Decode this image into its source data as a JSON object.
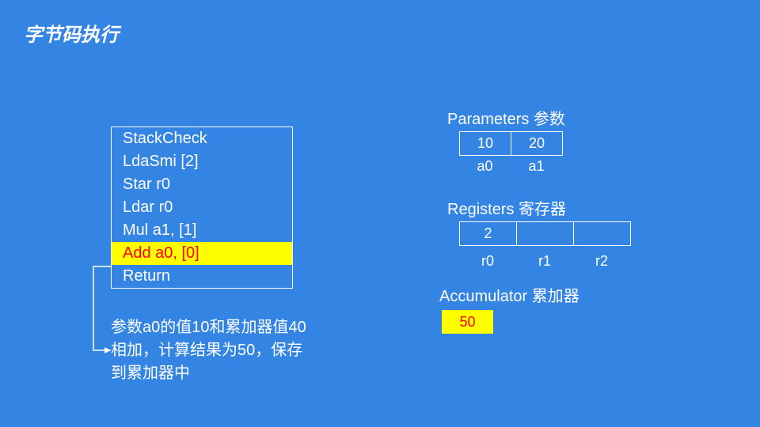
{
  "title": "字节码执行",
  "bytecode": [
    "StackCheck",
    "LdaSmi [2]",
    "Star r0",
    "Ldar r0",
    "Mul a1, [1]",
    "Add a0, [0]",
    "Return"
  ],
  "highlight_index": 5,
  "callout": "参数a0的值10和累加器值40相加，计算结果为50，保存到累加器中",
  "params": {
    "label": "Parameters 参数",
    "values": [
      "10",
      "20"
    ],
    "names": [
      "a0",
      "a1"
    ]
  },
  "registers": {
    "label": "Registers 寄存器",
    "values": [
      "2",
      "",
      ""
    ],
    "names": [
      "r0",
      "r1",
      "r2"
    ]
  },
  "accumulator": {
    "label": "Accumulator 累加器",
    "value": "50"
  }
}
